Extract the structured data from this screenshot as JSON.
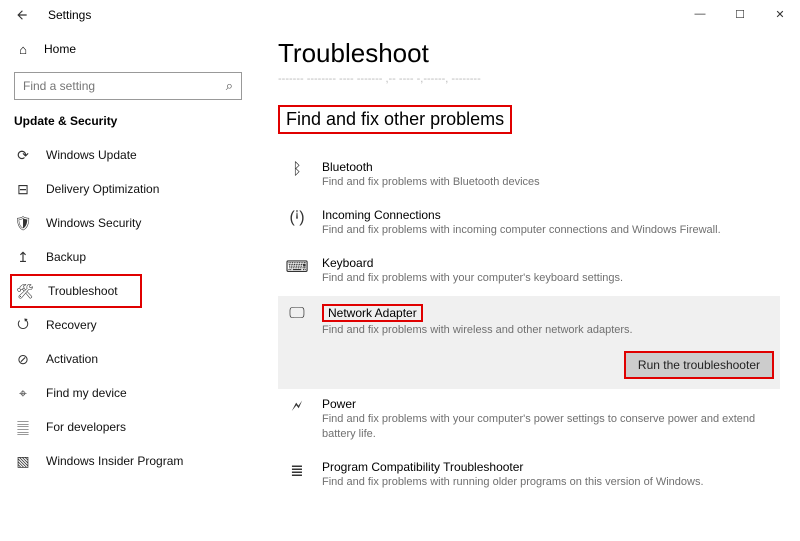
{
  "window": {
    "app_title": "Settings"
  },
  "sidebar": {
    "home": "Home",
    "search_placeholder": "Find a setting",
    "section": "Update & Security",
    "items": [
      {
        "label": "Windows Update"
      },
      {
        "label": "Delivery Optimization"
      },
      {
        "label": "Windows Security"
      },
      {
        "label": "Backup"
      },
      {
        "label": "Troubleshoot"
      },
      {
        "label": "Recovery"
      },
      {
        "label": "Activation"
      },
      {
        "label": "Find my device"
      },
      {
        "label": "For developers"
      },
      {
        "label": "Windows Insider Program"
      }
    ]
  },
  "main": {
    "title": "Troubleshoot",
    "faded": "------- --------  ----  -------  ,--  ----  -,------,  --------",
    "subheading": "Find and fix other problems",
    "items": [
      {
        "label": "Bluetooth",
        "desc": "Find and fix problems with Bluetooth devices"
      },
      {
        "label": "Incoming Connections",
        "desc": "Find and fix problems with incoming computer connections and Windows Firewall."
      },
      {
        "label": "Keyboard",
        "desc": "Find and fix problems with your computer's keyboard settings."
      },
      {
        "label": "Network Adapter",
        "desc": "Find and fix problems with wireless and other network adapters."
      },
      {
        "label": "Power",
        "desc": "Find and fix problems with your computer's power settings to conserve power and extend battery life."
      },
      {
        "label": "Program Compatibility Troubleshooter",
        "desc": "Find and fix problems with running older programs on this version of Windows."
      }
    ],
    "run_button": "Run the troubleshooter"
  }
}
